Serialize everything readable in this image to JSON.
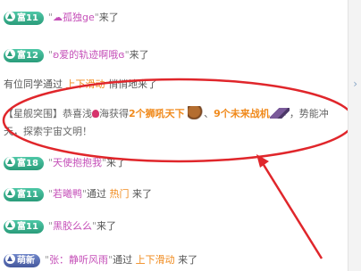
{
  "feed": {
    "rows": [
      {
        "badge": "富11",
        "name": "☁孤独ge",
        "suffix": "来了"
      },
      {
        "badge": "富12",
        "name": "ʚ爱的轨迹啊哦ɞ",
        "suffix": "来了"
      },
      {
        "prefix": "有位同学通过 ",
        "via": "上下滑动",
        "suffix": " 悄悄地来了"
      },
      {
        "badge": "富18",
        "name": "天使抱抱我",
        "suffix": "来了"
      },
      {
        "badge": "富11",
        "name": "若曦鸭",
        "via_text": "通过 ",
        "via": "热门",
        "suffix": " 来了"
      },
      {
        "badge": "富11",
        "name": "黑胶么么",
        "suffix": "来了"
      },
      {
        "badge": "萌新",
        "name": "张：静听风雨",
        "via_text": "通过 ",
        "via": "上下滑动",
        "suffix": " 来了"
      }
    ],
    "notice": {
      "tag": "【星舰突围】",
      "text1": "恭喜浅",
      "user": "海",
      "text2": "获得",
      "gift1": "2个狮吼天下",
      "sep": "、",
      "gift2": "9个未来战机",
      "text3": "，势能冲天，探索宇宙文明！"
    }
  }
}
